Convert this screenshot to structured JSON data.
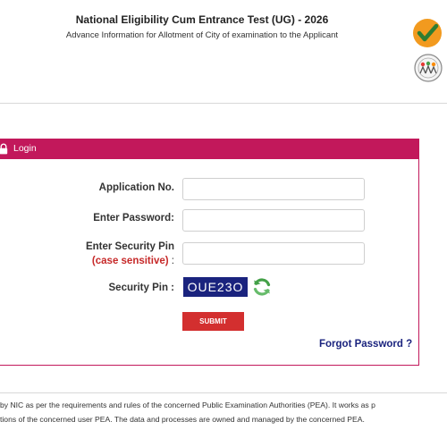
{
  "header": {
    "title": "National Eligibility Cum Entrance Test (UG) - 2026",
    "subtitle": "Advance Information for Allotment of City of examination to the Applicant"
  },
  "login": {
    "panel_title": "Login",
    "application_label": "Application No.",
    "application_value": "",
    "password_label": "Enter Password:",
    "password_value": "",
    "security_label": "Enter Security Pin",
    "security_note": "(case sensitive)",
    "security_colon": ":",
    "security_value": "",
    "pin_label": "Security Pin :",
    "pin_value": "OUE23O",
    "submit_label": "SUBMIT",
    "forgot_label": "Forgot Password ?"
  },
  "footer": {
    "line1": "by NIC as per the requirements and rules of the concerned Public Examination Authorities (PEA). It works as p",
    "line2": "tions of the concerned user PEA. The data and processes are owned and managed by the concerned PEA."
  },
  "colors": {
    "panel_accent": "#c2185b",
    "captcha_bg": "#1a237e",
    "submit_bg": "#d32f2f",
    "link": "#1a237e"
  },
  "icons": [
    "check-logo-icon",
    "seal-logo-icon",
    "lock-icon",
    "refresh-icon"
  ]
}
